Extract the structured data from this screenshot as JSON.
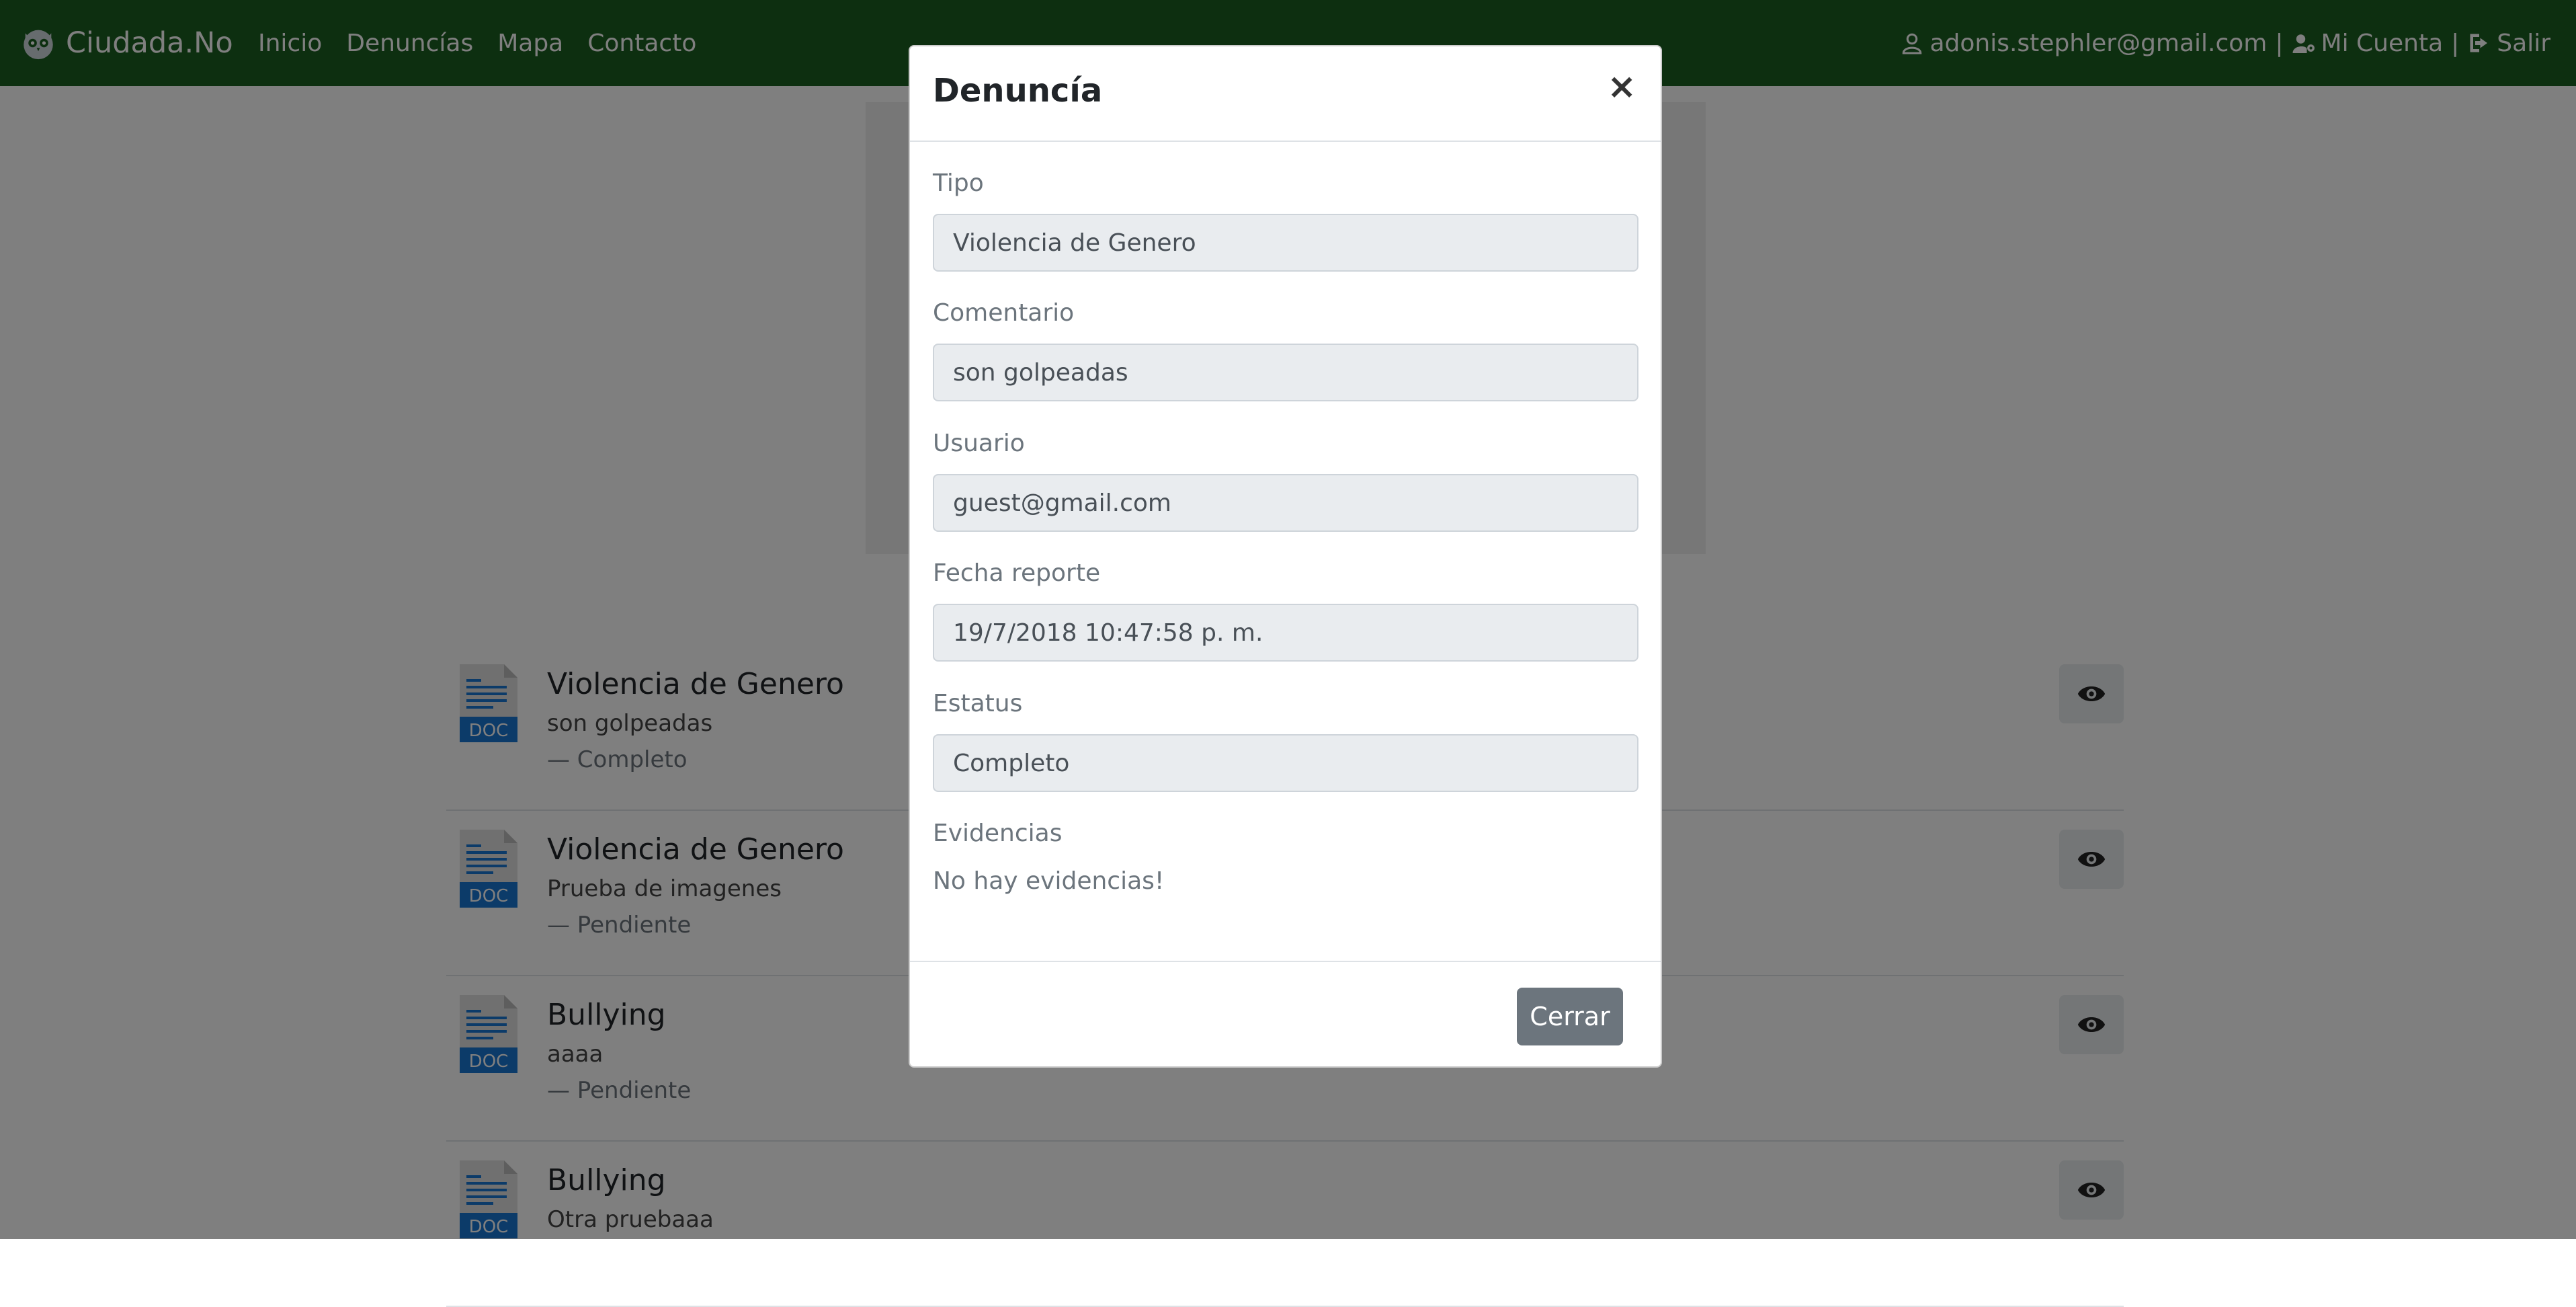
{
  "navbar": {
    "brand": "Ciudada.No",
    "links": [
      "Inicio",
      "Denuncías",
      "Mapa",
      "Contacto"
    ],
    "user_email": "adonis.stephler@gmail.com",
    "separator": "|",
    "account_label": "Mi Cuenta",
    "logout_label": "Salir"
  },
  "list": {
    "doc_badge": "DOC",
    "items": [
      {
        "title": "Violencia de Genero",
        "text": "son golpeadas",
        "status": "— Completo"
      },
      {
        "title": "Violencia de Genero",
        "text": "Prueba de imagenes",
        "status": "— Pendiente"
      },
      {
        "title": "Bullying",
        "text": "aaaa",
        "status": "— Pendiente"
      },
      {
        "title": "Bullying",
        "text": "Otra pruebaaa",
        "status": ""
      }
    ]
  },
  "modal": {
    "title": "Denuncía",
    "close_symbol": "×",
    "fields": {
      "tipo": {
        "label": "Tipo",
        "value": "Violencia de Genero"
      },
      "comentario": {
        "label": "Comentario",
        "value": "son golpeadas"
      },
      "usuario": {
        "label": "Usuario",
        "value": "guest@gmail.com"
      },
      "fecha": {
        "label": "Fecha reporte",
        "value": "19/7/2018 10:47:58 p. m."
      },
      "estatus": {
        "label": "Estatus",
        "value": "Completo"
      }
    },
    "evidencias_label": "Evidencias",
    "evidencias_empty": "No hay evidencias!",
    "close_button": "Cerrar"
  },
  "colors": {
    "navbar": "#1b5e20",
    "doc_badge": "#1976d2",
    "button_secondary": "#6c757d"
  }
}
